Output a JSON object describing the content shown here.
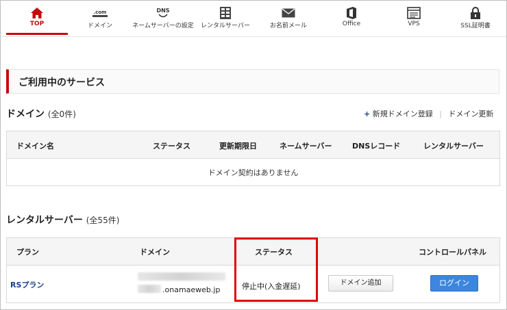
{
  "nav": [
    {
      "label": "TOP",
      "icon": "home-icon",
      "active": true
    },
    {
      "label": "ドメイン",
      "icon": "dotcom-icon",
      "icon_text": ".com"
    },
    {
      "label": "ネームサーバーの設定",
      "icon": "dns-icon",
      "icon_text": "DNS"
    },
    {
      "label": "レンタルサーバー",
      "icon": "server-icon"
    },
    {
      "label": "お名前メール",
      "icon": "mail-icon"
    },
    {
      "label": "Office",
      "icon": "office-icon"
    },
    {
      "label": "VPS",
      "icon": "vps-icon"
    },
    {
      "label": "SSL証明書",
      "icon": "ssl-lock-icon"
    }
  ],
  "services": {
    "heading": "ご利用中のサービス"
  },
  "domain": {
    "title": "ドメイン",
    "count": "(全0件)",
    "link_register": "新規ドメイン登録",
    "link_renew": "ドメイン更新",
    "columns": [
      "ドメイン名",
      "ステータス",
      "更新期限日",
      "ネームサーバー",
      "DNSレコード",
      "レンタルサーバー"
    ],
    "empty_text": "ドメイン契約はありません"
  },
  "rental": {
    "title": "レンタルサーバー",
    "count": "(全55件)",
    "columns": [
      "プラン",
      "ドメイン",
      "ステータス",
      "コントロールパネル"
    ],
    "row": {
      "plan": "RSプラン",
      "domain_visible": ".onamaeweb.jp",
      "status": "停止中(入金遅延)",
      "add_domain_button": "ドメイン追加",
      "login_button": "ログイン"
    }
  },
  "colors": {
    "accent": "#c40c0c",
    "link": "#1a3f8b",
    "login": "#3d86e0",
    "highlight": "#e00000"
  }
}
